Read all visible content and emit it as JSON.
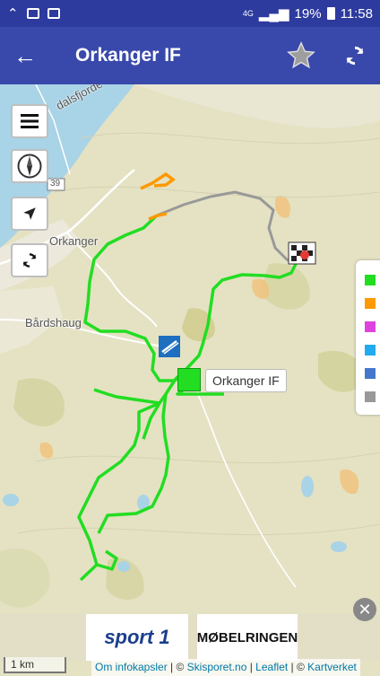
{
  "status_bar": {
    "network": "4G",
    "battery": "19%",
    "time": "11:58"
  },
  "app_bar": {
    "title": "Orkanger IF"
  },
  "map": {
    "places": {
      "orkanger": "Orkanger",
      "bardshaug": "Bårdshaug",
      "fjord": "dalsfjorde",
      "road_number": "39"
    },
    "marker_label": "Orkanger IF"
  },
  "legend": {
    "colors": [
      "#22dd22",
      "#ff9900",
      "#dd44dd",
      "#22aaee",
      "#4477cc",
      "#999999"
    ]
  },
  "ads": {
    "sponsor1": "sport 1",
    "sponsor2": "MØBELRINGEN"
  },
  "scale": {
    "label": "1 km"
  },
  "attribution": {
    "link1": "Om infokapsler",
    "sep1": " | © ",
    "link2": "Skisporet.no",
    "sep2": " | ",
    "link3": "Leaflet",
    "sep3": " | © ",
    "link4": "Kartverket"
  }
}
